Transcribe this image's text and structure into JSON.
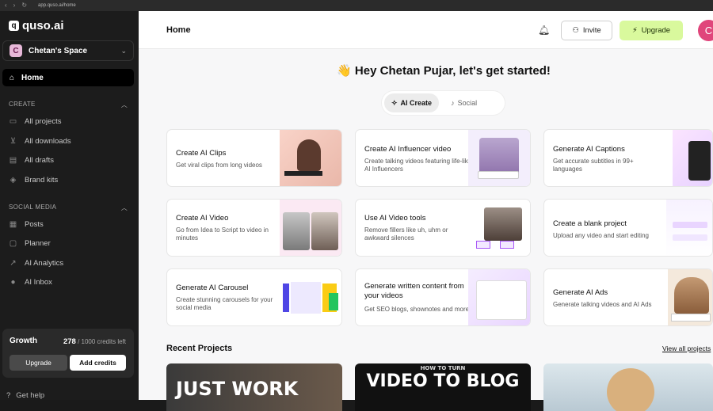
{
  "browser": {
    "url": "app.quso.ai/home"
  },
  "sidebar": {
    "logo": "quso.ai",
    "logo_mark": "q",
    "workspace": {
      "initial": "C",
      "name": "Chetan's Space"
    },
    "home_label": "Home",
    "create_section": "CREATE",
    "create_items": [
      {
        "label": "All projects",
        "icon": "folder-icon"
      },
      {
        "label": "All downloads",
        "icon": "download-icon"
      },
      {
        "label": "All drafts",
        "icon": "draft-icon"
      },
      {
        "label": "Brand kits",
        "icon": "brand-kit-icon"
      }
    ],
    "social_section": "SOCIAL MEDIA",
    "social_items": [
      {
        "label": "Posts",
        "icon": "posts-icon"
      },
      {
        "label": "Planner",
        "icon": "calendar-icon"
      },
      {
        "label": "AI Analytics",
        "icon": "analytics-icon"
      },
      {
        "label": "AI Inbox",
        "icon": "inbox-icon"
      }
    ],
    "growth": {
      "title": "Growth",
      "credits_used": "278",
      "credits_total": "/ 1000 credits left",
      "upgrade": "Upgrade",
      "add_credits": "Add credits"
    },
    "help": "Get help"
  },
  "header": {
    "title": "Home",
    "invite": "Invite",
    "upgrade": "Upgrade",
    "avatar": "C"
  },
  "greeting": "👋 Hey Chetan Pujar, let's get started!",
  "tabs": [
    {
      "label": "AI Create",
      "active": true
    },
    {
      "label": "Social",
      "active": false
    }
  ],
  "cards": [
    {
      "title": "Create AI Clips",
      "desc": "Get viral clips from long videos"
    },
    {
      "title": "Create AI Influencer video",
      "desc": "Create talking videos featuring life-like AI Influencers"
    },
    {
      "title": "Generate AI Captions",
      "desc": "Get accurate subtitles in 99+ languages"
    },
    {
      "title": "Create AI Video",
      "desc": "Go from Idea to Script to video in minutes"
    },
    {
      "title": "Use AI Video tools",
      "desc": "Remove fillers like uh, uhm or awkward silences"
    },
    {
      "title": "Create a blank project",
      "desc": "Upload any video and start editing"
    },
    {
      "title": "Generate AI Carousel",
      "desc": "Create stunning carousels for your social media"
    },
    {
      "title": "Generate written content from your videos",
      "desc": "Get SEO blogs, shownotes and more"
    },
    {
      "title": "Generate AI Ads",
      "desc": "Generate talking videos and AI Ads"
    }
  ],
  "recent": {
    "title": "Recent Projects",
    "view_all": "View all projects",
    "thumbs": [
      "JUST WORK",
      "VIDEO TO BLOG",
      ""
    ],
    "thumb_kicker": "HOW TO TURN"
  },
  "colors": {
    "accent": "#d9f99d",
    "avatar": "#e0457b",
    "sidebar": "#1c1c1c"
  }
}
